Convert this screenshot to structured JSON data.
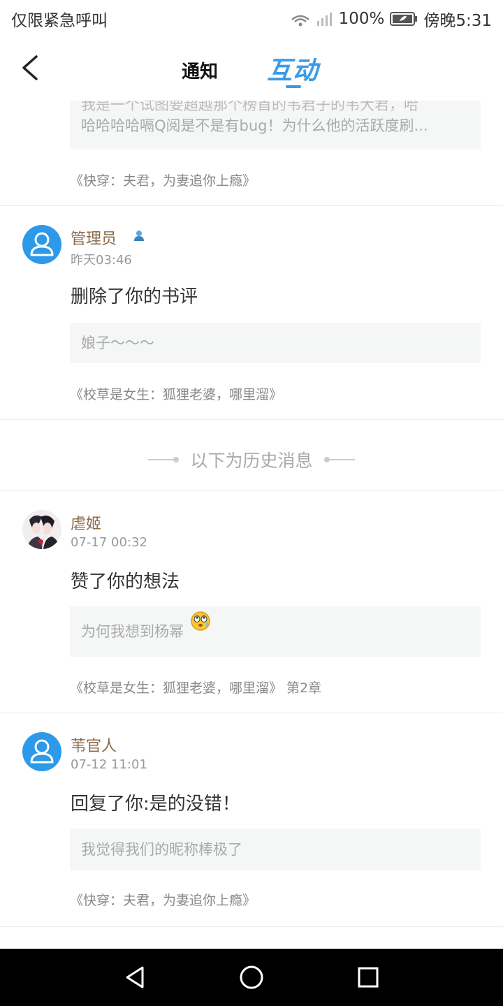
{
  "status_bar": {
    "carrier": "仅限紧急呼叫",
    "battery": "100%",
    "time": "傍晚5:31"
  },
  "header": {
    "tabs": [
      "通知",
      "互动"
    ],
    "active_tab": "互动"
  },
  "colors": {
    "accent": "#3a9be8",
    "username": "#8a6a4a"
  },
  "items": [
    {
      "quote_partial_line1": "我是一个试图要超越那个榜首的韦君子的韦大君，哈",
      "quote_partial_line2": "哈哈哈哈嗝Q阅是不是有bug！为什么他的活跃度刷...",
      "book": "《快穿：夫君，为妻追你上瘾》"
    },
    {
      "user": "管理员",
      "badge_icon": "admin-badge-icon",
      "time": "昨天03:46",
      "action": "删除了你的书评",
      "quote": "娘子～～～",
      "book": "《校草是女生：狐狸老婆，哪里溜》"
    }
  ],
  "history_label": "以下为历史消息",
  "history_items": [
    {
      "user": "虐姬",
      "time": "07-17 00:32",
      "action": "赞了你的想法",
      "quote": "为何我想到杨幂",
      "book": "《校草是女生：狐狸老婆，哪里溜》 第2章"
    },
    {
      "user": "苇官人",
      "time": "07-12 11:01",
      "action": "回复了你:是的没错！",
      "quote": "我觉得我们的昵称棒极了",
      "book": "《快穿：夫君，为妻追你上瘾》"
    }
  ]
}
